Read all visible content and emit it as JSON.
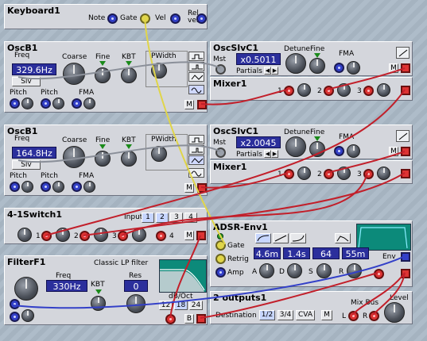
{
  "keyboard": {
    "title": "Keyboard1",
    "note": "Note",
    "gate": "Gate",
    "vel": "Vel",
    "relvel_a": "Rel",
    "relvel_b": "vel"
  },
  "osc1": {
    "title": "OscB1",
    "freq_label": "Freq",
    "freq": "329.6Hz",
    "coarse": "Coarse",
    "fine": "Fine",
    "kbt": "KBT",
    "pwidth": "PWidth",
    "slv": "Slv",
    "pitch1": "Pitch",
    "pitch2": "Pitch",
    "fma": "FMA"
  },
  "slv1": {
    "title": "OscSlvC1",
    "mst": "Mst",
    "detune": "Detune",
    "fine": "Fine",
    "fma": "FMA",
    "ratio": "x0.5011",
    "partials": "Partials"
  },
  "mixer1": {
    "title": "Mixer1",
    "in1": "1",
    "in2": "2",
    "in3": "3"
  },
  "osc2": {
    "title": "OscB1",
    "freq_label": "Freq",
    "freq": "164.8Hz",
    "coarse": "Coarse",
    "fine": "Fine",
    "kbt": "KBT",
    "pwidth": "PWidth",
    "slv": "Slv",
    "pitch1": "Pitch",
    "pitch2": "Pitch",
    "fma": "FMA"
  },
  "slv2": {
    "title": "OscSlvC1",
    "mst": "Mst",
    "detune": "Detune",
    "fine": "Fine",
    "fma": "FMA",
    "ratio": "x2.0045",
    "partials": "Partials"
  },
  "mixer2": {
    "title": "Mixer1",
    "in1": "1",
    "in2": "2",
    "in3": "3"
  },
  "switch": {
    "title": "4-1Switch1",
    "input": "Input",
    "btns": [
      "1",
      "2",
      "3",
      "4"
    ],
    "in1": "1",
    "in2": "2",
    "in3": "3",
    "in4": "4"
  },
  "adsr": {
    "title": "ADSR-Env1",
    "gate": "Gate",
    "retrig": "Retrig",
    "amp": "Amp",
    "a": "A",
    "d": "D",
    "s": "S",
    "r": "R",
    "val_a": "4.6m",
    "val_d": "1.4s",
    "val_s": "64",
    "val_r": "55m",
    "env": "Env"
  },
  "filter": {
    "title": "FilterF1",
    "subtitle": "Classic LP filter",
    "freq_label": "Freq",
    "freq": "330Hz",
    "kbt": "KBT",
    "res_label": "Res",
    "res": "0",
    "db_label": "dB/Oct",
    "slopes": [
      "12",
      "18",
      "24"
    ],
    "b": "B"
  },
  "outputs": {
    "title": "2 outputs1",
    "destination": "Destination",
    "dests": [
      "1/2",
      "3/4",
      "CVA"
    ],
    "m": "M",
    "mixbus": "Mix Bus",
    "level": "Level",
    "l": "L",
    "r": "R"
  },
  "m_button": "M",
  "colors": {
    "bg": "#a9b7c4",
    "panel": "#d4d6dc",
    "display": "#2b2f9c",
    "cable_red": "#c21f2a",
    "cable_blue": "#3340c8",
    "cable_yellow": "#e0d54a"
  }
}
